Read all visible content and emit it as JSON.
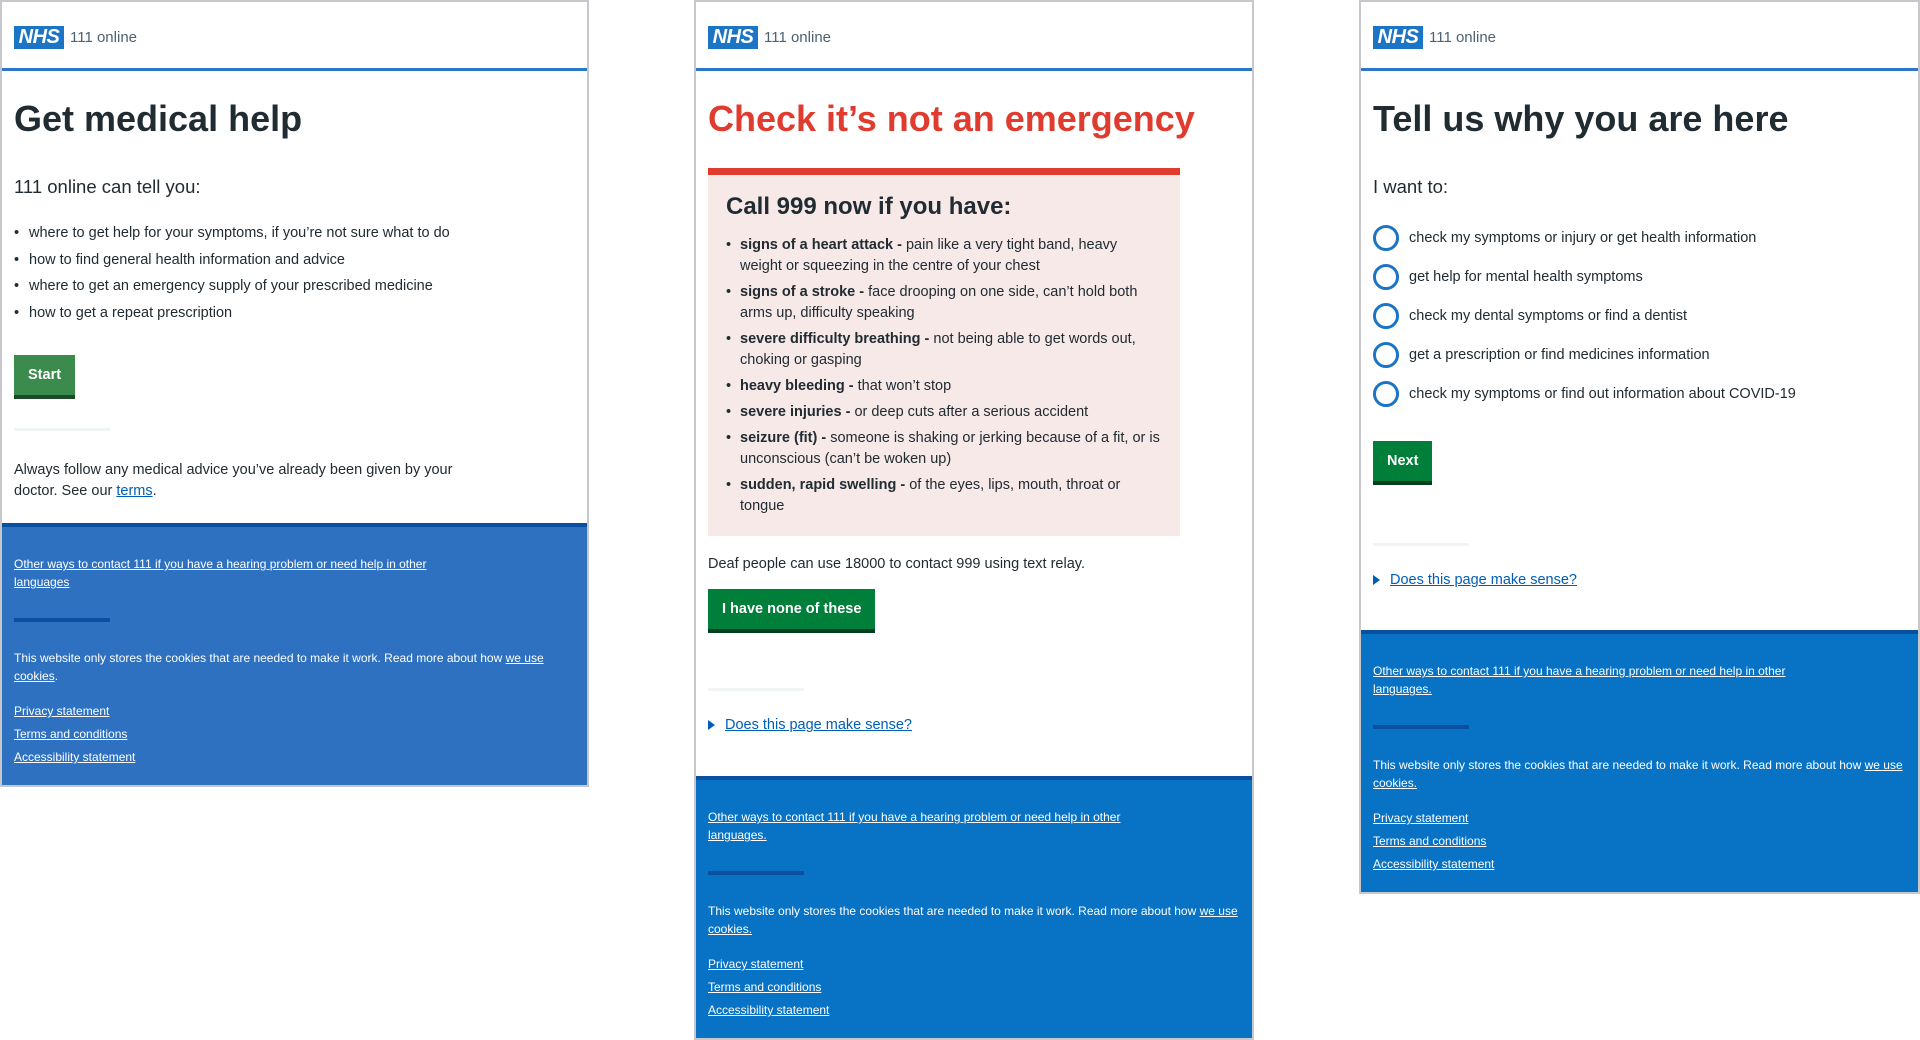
{
  "brand": {
    "logo": "NHS",
    "service": "111 online",
    "colors": {
      "nhs_blue": "#005eb8",
      "green": "#007f3b",
      "red": "#e03b2f",
      "footer_blue": "#0872c4"
    }
  },
  "panels": [
    {
      "title": "Get medical help",
      "lead": "111 online can tell you:",
      "bullets": [
        "where to get help for your symptoms, if you’re not sure what to do",
        "how to find general health information and advice",
        "where to get an emergency supply of your prescribed medicine",
        "how to get a repeat prescription"
      ],
      "button": "Start",
      "advice_text": "Always follow any medical advice you’ve already been given by your doctor. See our ",
      "advice_link": "terms",
      "advice_end": "."
    },
    {
      "title": "Check it’s not an emergency",
      "callout_heading": "Call 999 now if you have:",
      "items": [
        {
          "bold": "signs of a heart attack -",
          "text": " pain like a very tight band, heavy weight or squeezing in the centre of your chest"
        },
        {
          "bold": "signs of a stroke -",
          "text": " face drooping on one side, can’t hold both arms up, difficulty speaking"
        },
        {
          "bold": "severe difficulty breathing -",
          "text": " not being able to get words out, choking or gasping"
        },
        {
          "bold": "heavy bleeding -",
          "text": " that won’t stop"
        },
        {
          "bold": "severe injuries -",
          "text": " or deep cuts after a serious accident"
        },
        {
          "bold": "seizure (fit) -",
          "text": " someone is shaking or jerking because of a fit, or is unconscious (can’t be woken up)"
        },
        {
          "bold": "sudden, rapid swelling -",
          "text": " of the eyes, lips, mouth, throat or tongue"
        }
      ],
      "deaf_text": "Deaf people can use 18000 to contact 999 using text relay.",
      "button": "I have none of these",
      "feedback": "Does this page make sense?"
    },
    {
      "title": "Tell us why you are here",
      "lead": "I want to:",
      "options": [
        "check my symptoms or injury or get health information",
        "get help for mental health symptoms",
        "check my dental symptoms or find a dentist",
        "get a prescription or find medicines information",
        "check my symptoms or find out information about COVID-19"
      ],
      "button": "Next",
      "feedback": "Does this page make sense?"
    }
  ],
  "footers": [
    {
      "other_ways": "Other ways to contact 111 if you have a hearing problem or need help in other languages",
      "cookie_text": "This website only stores the cookies that are needed to make it work. Read more about how ",
      "cookie_link": "we use cookies",
      "cookie_end": "."
    },
    {
      "other_ways": "Other ways to contact 111 if you have a hearing problem or need help in other languages.",
      "cookie_text": "This website only stores the cookies that are needed to make it work. Read more about how ",
      "cookie_link": "we use cookies.",
      "cookie_end": ""
    },
    {
      "other_ways": "Other ways to contact 111 if you have a hearing problem or need help in other languages.",
      "cookie_text": "This website only stores the cookies that are needed to make it work. Read more about how ",
      "cookie_link": "we use cookies.",
      "cookie_end": ""
    }
  ],
  "footer_links": [
    "Privacy statement",
    "Terms and conditions",
    "Accessibility statement"
  ]
}
